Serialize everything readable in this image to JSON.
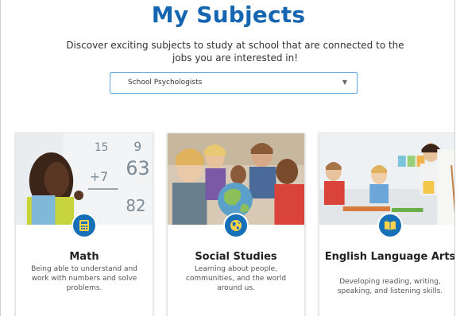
{
  "header": {
    "title": "My Subjects",
    "subtitle": "Discover exciting subjects to study at school that are connected to the jobs you are interested in!"
  },
  "career_select": {
    "selected": "School Psychologists"
  },
  "cards": [
    {
      "title": "Math",
      "description": "Being able to understand and work with numbers and solve problems.",
      "icon": "calculator-icon"
    },
    {
      "title": "Social Studies",
      "description": "Learning about people, communities, and the world around us.",
      "icon": "globe-icon"
    },
    {
      "title": "English Language Arts",
      "description": "Developing reading, writing, speaking, and listening skills.",
      "icon": "book-icon"
    }
  ],
  "colors": {
    "title": "#1565b0",
    "badge": "#1570b8",
    "select_border": "#5ba6dc"
  }
}
